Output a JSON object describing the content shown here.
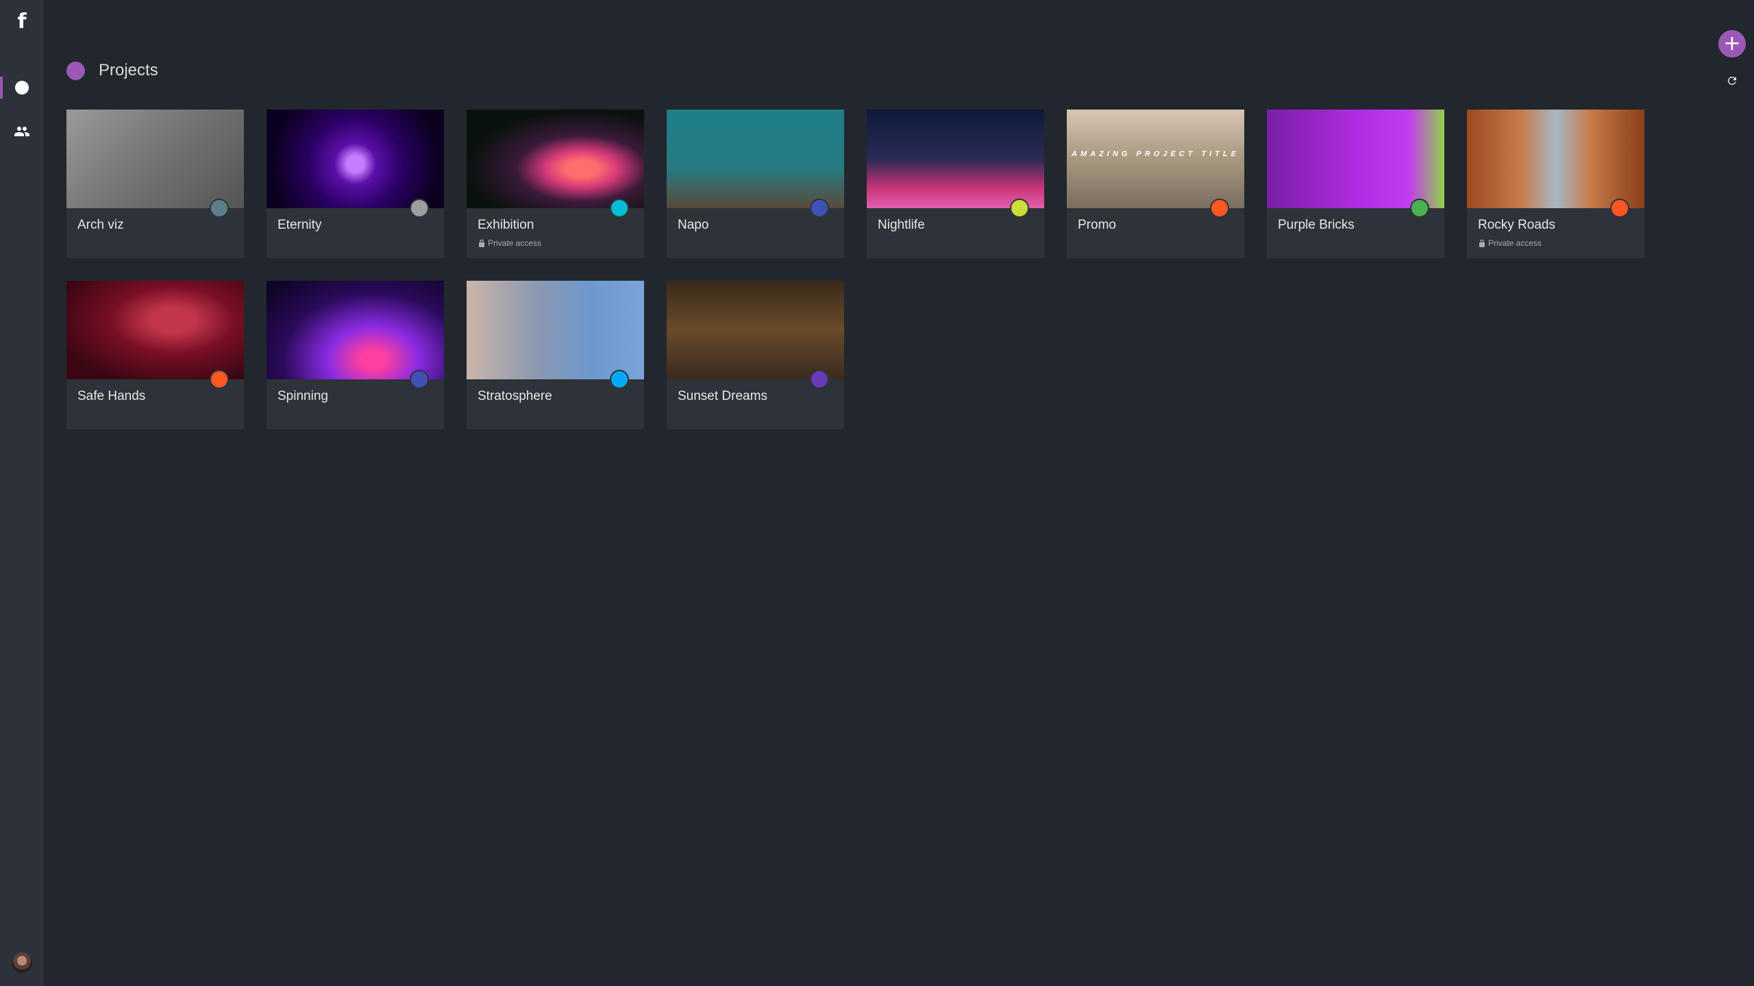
{
  "app": {
    "logo": "f"
  },
  "sidebar": {
    "items": [
      {
        "id": "projects",
        "label": "Projects",
        "icon": "circle-icon",
        "active": true
      },
      {
        "id": "team",
        "label": "Team",
        "icon": "people-icon",
        "active": false
      }
    ],
    "avatar": "user-avatar"
  },
  "header": {
    "title": "Projects",
    "accent": "#9b59b6"
  },
  "toolbar": {
    "add_label": "+",
    "add_icon": "plus-icon",
    "refresh_icon": "refresh-icon"
  },
  "projects": [
    {
      "name": "Arch viz",
      "status_color": "#607d8b",
      "private": false,
      "thumb": "t-archviz"
    },
    {
      "name": "Eternity",
      "status_color": "#9e9e9e",
      "private": false,
      "thumb": "t-eternity"
    },
    {
      "name": "Exhibition",
      "status_color": "#00bcd4",
      "private": true,
      "access_label": "Private access",
      "thumb": "t-exhibition"
    },
    {
      "name": "Napo",
      "status_color": "#3f51b5",
      "private": false,
      "thumb": "t-napo"
    },
    {
      "name": "Nightlife",
      "status_color": "#cddc39",
      "private": false,
      "thumb": "t-nightlife"
    },
    {
      "name": "Promo",
      "status_color": "#ff5722",
      "private": false,
      "thumb": "t-promo",
      "thumb_text": "AMAZING PROJECT TITLE"
    },
    {
      "name": "Purple Bricks",
      "status_color": "#4caf50",
      "private": false,
      "thumb": "t-purplebricks"
    },
    {
      "name": "Rocky Roads",
      "status_color": "#ff5722",
      "private": true,
      "access_label": "Private access",
      "thumb": "t-rockyroads"
    },
    {
      "name": "Safe Hands",
      "status_color": "#ff5722",
      "private": false,
      "thumb": "t-safehands"
    },
    {
      "name": "Spinning",
      "status_color": "#3f51b5",
      "private": false,
      "thumb": "t-spinning"
    },
    {
      "name": "Stratosphere",
      "status_color": "#03a9f4",
      "private": false,
      "thumb": "t-stratosphere"
    },
    {
      "name": "Sunset Dreams",
      "status_color": "#673ab7",
      "private": false,
      "thumb": "t-sunsetdreams"
    }
  ]
}
